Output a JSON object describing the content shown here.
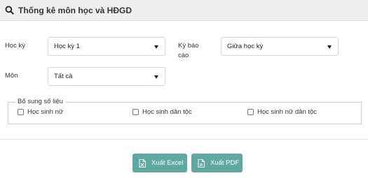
{
  "header": {
    "title": "Thống kê môn học và HĐGD",
    "icon": "search-icon"
  },
  "filters": {
    "semester": {
      "label": "Học kỳ",
      "value": "Học kỳ 1"
    },
    "report_period": {
      "label_line1": "Kỳ báo",
      "label_line2": "cáo",
      "value": "Giữa học kỳ"
    },
    "subject": {
      "label": "Môn",
      "value": "Tất cả"
    }
  },
  "supplement": {
    "legend": "Bổ sung số liệu",
    "options": [
      {
        "label": "Học sinh nữ",
        "checked": false
      },
      {
        "label": "Học sinh dân tộc",
        "checked": false
      },
      {
        "label": "Học sinh nữ dân tộc",
        "checked": false
      }
    ]
  },
  "actions": {
    "export_excel": {
      "label": "Xuất Excel",
      "icon": "file-icon"
    },
    "export_pdf": {
      "label": "Xuất PDF",
      "icon": "file-icon"
    }
  },
  "colors": {
    "button": "#5fa9a2",
    "header_bg": "#efefef"
  }
}
